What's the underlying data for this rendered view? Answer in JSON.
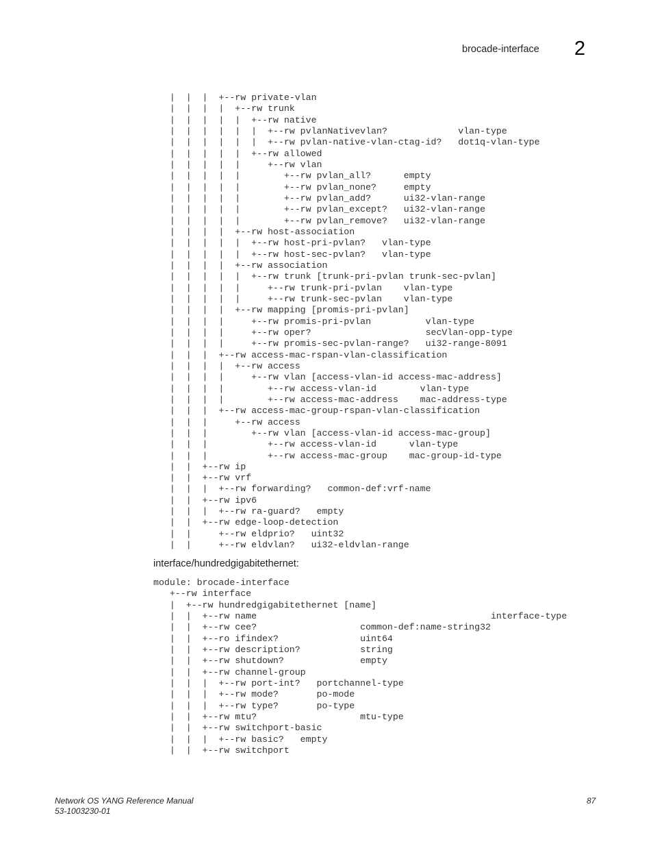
{
  "header": {
    "section_title": "brocade-interface",
    "chapter_number": "2"
  },
  "code_block_1": [
    "   |  |  |  +--rw private-vlan",
    "   |  |  |  |  +--rw trunk",
    "   |  |  |  |  |  +--rw native",
    "   |  |  |  |  |  |  +--rw pvlanNativevlan?             vlan-type",
    "   |  |  |  |  |  |  +--rw pvlan-native-vlan-ctag-id?   dot1q-vlan-type",
    "   |  |  |  |  |  +--rw allowed",
    "   |  |  |  |  |     +--rw vlan",
    "   |  |  |  |  |        +--rw pvlan_all?      empty",
    "   |  |  |  |  |        +--rw pvlan_none?     empty",
    "   |  |  |  |  |        +--rw pvlan_add?      ui32-vlan-range",
    "   |  |  |  |  |        +--rw pvlan_except?   ui32-vlan-range",
    "   |  |  |  |  |        +--rw pvlan_remove?   ui32-vlan-range",
    "   |  |  |  |  +--rw host-association",
    "   |  |  |  |  |  +--rw host-pri-pvlan?   vlan-type",
    "   |  |  |  |  |  +--rw host-sec-pvlan?   vlan-type",
    "   |  |  |  |  +--rw association",
    "   |  |  |  |  |  +--rw trunk [trunk-pri-pvlan trunk-sec-pvlan]",
    "   |  |  |  |  |     +--rw trunk-pri-pvlan    vlan-type",
    "   |  |  |  |  |     +--rw trunk-sec-pvlan    vlan-type",
    "   |  |  |  |  +--rw mapping [promis-pri-pvlan]",
    "   |  |  |  |     +--rw promis-pri-pvlan          vlan-type",
    "   |  |  |  |     +--rw oper?                     secVlan-opp-type",
    "   |  |  |  |     +--rw promis-sec-pvlan-range?   ui32-range-8091",
    "   |  |  |  +--rw access-mac-rspan-vlan-classification",
    "   |  |  |  |  +--rw access",
    "   |  |  |  |     +--rw vlan [access-vlan-id access-mac-address]",
    "   |  |  |  |        +--rw access-vlan-id        vlan-type",
    "   |  |  |  |        +--rw access-mac-address    mac-address-type",
    "   |  |  |  +--rw access-mac-group-rspan-vlan-classification",
    "   |  |  |     +--rw access",
    "   |  |  |        +--rw vlan [access-vlan-id access-mac-group]",
    "   |  |  |           +--rw access-vlan-id      vlan-type",
    "   |  |  |           +--rw access-mac-group    mac-group-id-type",
    "   |  |  +--rw ip",
    "   |  |  +--rw vrf",
    "   |  |  |  +--rw forwarding?   common-def:vrf-name",
    "   |  |  +--rw ipv6",
    "   |  |  |  +--rw ra-guard?   empty",
    "   |  |  +--rw edge-loop-detection",
    "   |  |     +--rw eldprio?   uint32",
    "   |  |     +--rw eldvlan?   ui32-eldvlan-range"
  ],
  "section_heading": "interface/hundredgigabitethernet:",
  "code_block_2": [
    "module: brocade-interface",
    "   +--rw interface",
    "   |  +--rw hundredgigabitethernet [name]",
    "   |  |  +--rw name                                           interface-type",
    "   |  |  +--rw cee?                   common-def:name-string32",
    "   |  |  +--ro ifindex?               uint64",
    "   |  |  +--rw description?           string",
    "   |  |  +--rw shutdown?              empty",
    "   |  |  +--rw channel-group",
    "   |  |  |  +--rw port-int?   portchannel-type",
    "   |  |  |  +--rw mode?       po-mode",
    "   |  |  |  +--rw type?       po-type",
    "   |  |  +--rw mtu?                   mtu-type",
    "   |  |  +--rw switchport-basic",
    "   |  |  |  +--rw basic?   empty",
    "   |  |  +--rw switchport"
  ],
  "footer": {
    "manual_title": "Network OS YANG Reference Manual",
    "document_number": "53-1003230-01",
    "page_number": "87"
  }
}
